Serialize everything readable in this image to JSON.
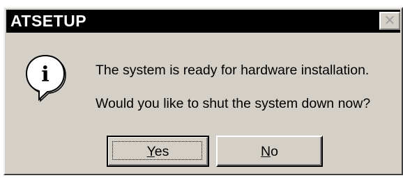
{
  "window": {
    "title": "ATSETUP",
    "close_glyph": "✕"
  },
  "icon": {
    "name": "info-icon",
    "glyph": "i"
  },
  "message": {
    "line1": "The system is ready for hardware installation.",
    "line2": "Would you like to shut the system down now?"
  },
  "buttons": {
    "yes": {
      "mnemonic": "Y",
      "rest": "es"
    },
    "no": {
      "mnemonic": "N",
      "rest": "o"
    }
  },
  "colors": {
    "titlebar": "#000000",
    "face": "#d4d0c8"
  }
}
